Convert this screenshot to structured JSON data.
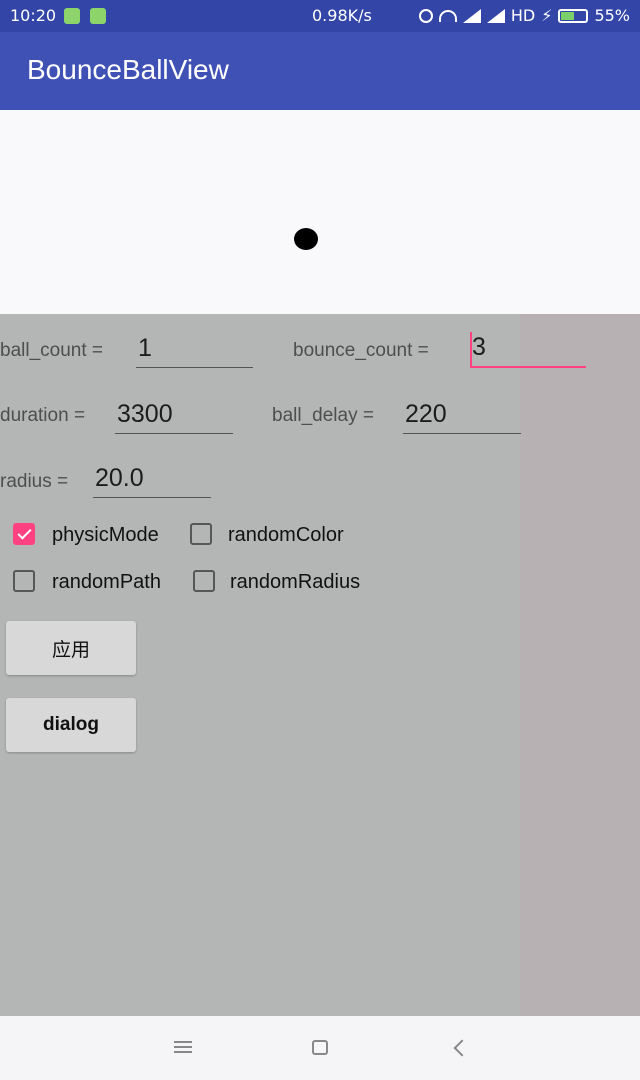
{
  "status_bar": {
    "time": "10:20",
    "speed": "0.98K/s",
    "network": "HD",
    "battery": "55%",
    "battery_level": 0.55
  },
  "app": {
    "title": "BounceBallView"
  },
  "fields": {
    "ball_count": {
      "label": "ball_count  =",
      "value": "1"
    },
    "bounce_count": {
      "label": "bounce_count  =",
      "value": "3"
    },
    "duration": {
      "label": "duration  =",
      "value": "3300"
    },
    "ball_delay": {
      "label": "ball_delay  =",
      "value": "220"
    },
    "radius": {
      "label": "radius  =",
      "value": "20.0"
    }
  },
  "checkboxes": {
    "physicMode": {
      "label": "physicMode",
      "checked": true
    },
    "randomColor": {
      "label": "randomColor",
      "checked": false
    },
    "randomPath": {
      "label": "randomPath",
      "checked": false
    },
    "randomRadius": {
      "label": "randomRadius",
      "checked": false
    }
  },
  "buttons": {
    "apply": "应用",
    "dialog": "dialog"
  },
  "colors": {
    "primary": "#3f51b5",
    "accent": "#ff4081",
    "status_bar": "#3346a8"
  }
}
